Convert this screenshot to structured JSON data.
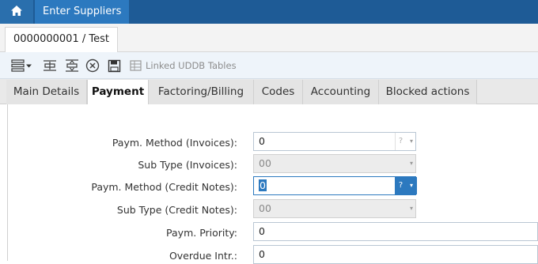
{
  "header": {
    "app_title": "Enter Suppliers"
  },
  "record_tab": {
    "label": "0000000001 / Test"
  },
  "toolbar": {
    "linked_tables_label": "Linked UDDB Tables"
  },
  "tabs": [
    {
      "label": "Main Details"
    },
    {
      "label": "Payment"
    },
    {
      "label": "Factoring/Billing"
    },
    {
      "label": "Codes"
    },
    {
      "label": "Accounting"
    },
    {
      "label": "Blocked actions"
    }
  ],
  "active_tab": "Payment",
  "form": {
    "paym_method_invoices": {
      "label": "Paym. Method (Invoices):",
      "value": "0"
    },
    "sub_type_invoices": {
      "label": "Sub Type (Invoices):",
      "value": "00"
    },
    "paym_method_credit_notes": {
      "label": "Paym. Method (Credit Notes):",
      "value": "0"
    },
    "sub_type_credit_notes": {
      "label": "Sub Type (Credit Notes):",
      "value": "00"
    },
    "paym_priority": {
      "label": "Paym. Priority:",
      "value": "0"
    },
    "overdue_intr": {
      "label": "Overdue Intr.:",
      "value": "0"
    }
  },
  "lookup_glyph": "?",
  "dropdown_glyph": "▾",
  "colors": {
    "nav_bar": "#1e5b96",
    "accent": "#2c79bf",
    "toolbar_bg": "#eef4fa"
  }
}
